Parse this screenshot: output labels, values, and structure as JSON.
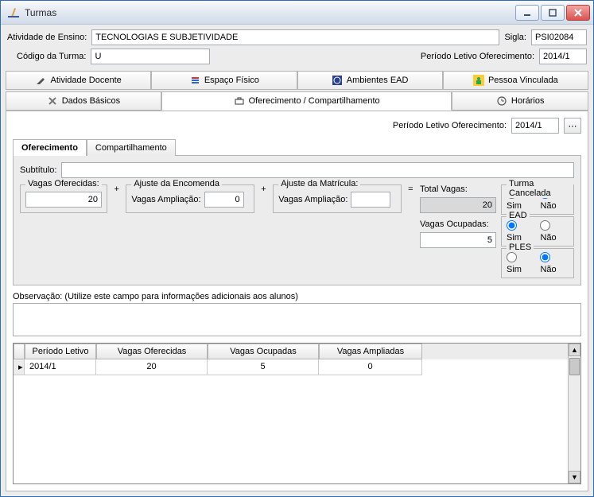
{
  "window": {
    "title": "Turmas"
  },
  "header": {
    "atividade_label": "Atividade de Ensino:",
    "atividade": "TECNOLOGIAS E SUBJETIVIDADE",
    "sigla_label": "Sigla:",
    "sigla": "PSI02084",
    "codigo_label": "Código da Turma:",
    "codigo": "U",
    "periodo_label": "Período Letivo Oferecimento:",
    "periodo": "2014/1"
  },
  "tabs": {
    "atividade_docente": "Atividade Docente",
    "espaco_fisico": "Espaço Físico",
    "ambientes_ead": "Ambientes EAD",
    "pessoa_vinculada": "Pessoa Vinculada",
    "dados_basicos": "Dados Básicos",
    "oferecimento": "Oferecimento / Compartilhamento",
    "horarios": "Horários"
  },
  "content": {
    "periodo_label": "Período Letivo Oferecimento:",
    "periodo": "2014/1",
    "subtabs": {
      "oferecimento": "Oferecimento",
      "compartilhamento": "Compartilhamento"
    },
    "subtitulo_label": "Subtítulo:",
    "subtitulo": "",
    "vagas": {
      "oferecidas_label": "Vagas Oferecidas:",
      "oferecidas": "20",
      "ajuste_encomenda_legend": "Ajuste da Encomenda",
      "vagas_ampliacao_label": "Vagas Ampliação:",
      "vagas_ampliacao_encomenda": "0",
      "ajuste_matricula_legend": "Ajuste da Matrícula:",
      "vagas_ampliacao_matricula": "",
      "total_label": "Total Vagas:",
      "total": "20",
      "ocupadas_label": "Vagas Ocupadas:",
      "ocupadas": "5"
    },
    "radios": {
      "turma_cancelada_legend": "Turma Cancelada",
      "ead_legend": "EAD",
      "ples_legend": "PLES",
      "sim": "Sim",
      "nao": "Não"
    },
    "observacao_label": "Observação: (Utilize este campo para informações adicionais aos alunos)",
    "grid": {
      "cols": [
        "Período Letivo",
        "Vagas Oferecidas",
        "Vagas Ocupadas",
        "Vagas Ampliadas"
      ],
      "rows": [
        {
          "periodo": "2014/1",
          "oferecidas": "20",
          "ocupadas": "5",
          "ampliadas": "0"
        }
      ]
    }
  }
}
